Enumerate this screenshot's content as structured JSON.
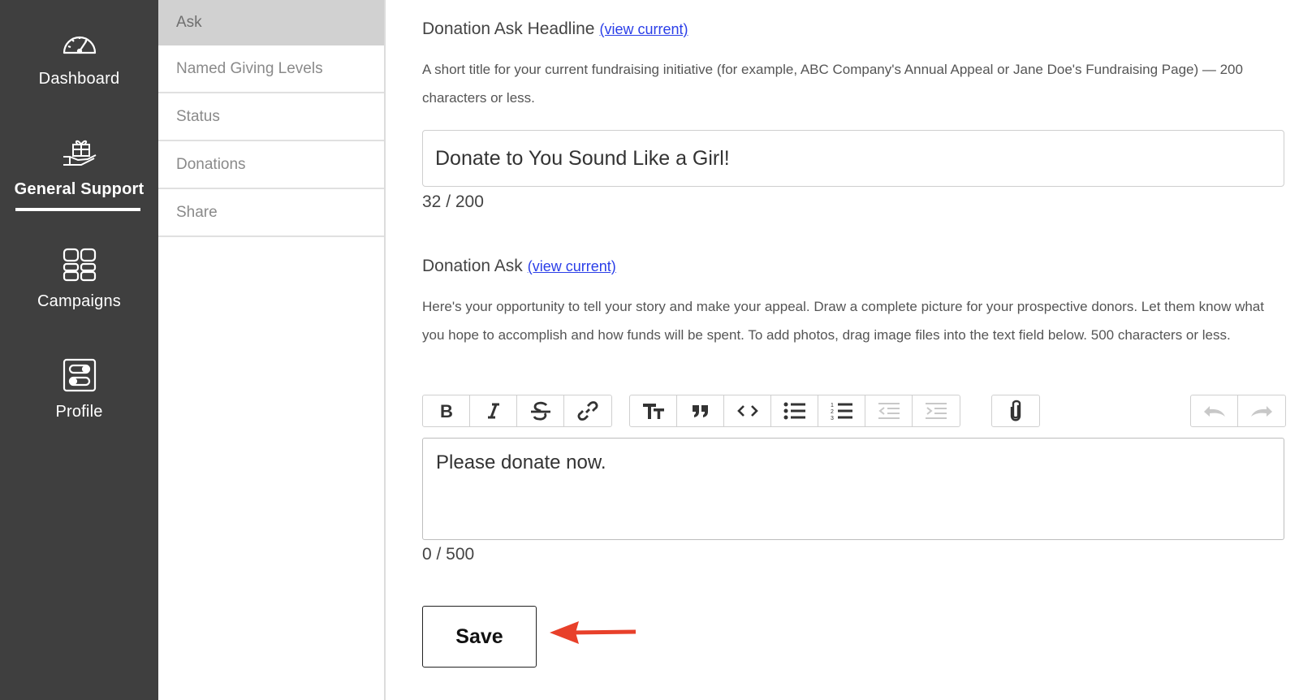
{
  "leftnav": {
    "items": [
      {
        "label": "Dashboard",
        "icon": "speedometer-icon"
      },
      {
        "label": "General Support",
        "icon": "gift-hand-icon",
        "active": true
      },
      {
        "label": "Campaigns",
        "icon": "grid-icon"
      },
      {
        "label": "Profile",
        "icon": "toggle-panel-icon"
      }
    ]
  },
  "subnav": {
    "items": [
      {
        "label": "Ask",
        "active": true
      },
      {
        "label": "Named Giving Levels"
      },
      {
        "label": "Status"
      },
      {
        "label": "Donations"
      },
      {
        "label": "Share"
      }
    ]
  },
  "headline": {
    "label": "Donation Ask Headline",
    "view_link": "(view current)",
    "help": "A short title for your current fundraising initiative (for example, ABC Company's Annual Appeal or Jane Doe's Fundraising Page) — 200 characters or less.",
    "value": "Donate to You Sound Like a Girl!",
    "counter": "32 / 200"
  },
  "ask": {
    "label": "Donation Ask",
    "view_link": "(view current)",
    "help": "Here's your opportunity to tell your story and make your appeal. Draw a complete picture for your prospective donors. Let them know what you hope to accomplish and how funds will be spent. To add photos, drag image files into the text field below. 500 characters or less.",
    "value": "Please donate now.",
    "counter": "0 / 500"
  },
  "toolbar": {
    "buttons": [
      "bold-icon",
      "italic-icon",
      "strikethrough-icon",
      "link-icon",
      "heading-icon",
      "quote-icon",
      "code-icon",
      "bullet-list-icon",
      "numbered-list-icon",
      "outdent-icon",
      "indent-icon",
      "attach-icon",
      "undo-icon",
      "redo-icon"
    ]
  },
  "actions": {
    "save_label": "Save"
  },
  "colors": {
    "sidebar_bg": "#3f3f3f",
    "active_subnav_bg": "#d1d1d1",
    "link": "#2a3ee8",
    "arrow": "#e8402a"
  }
}
